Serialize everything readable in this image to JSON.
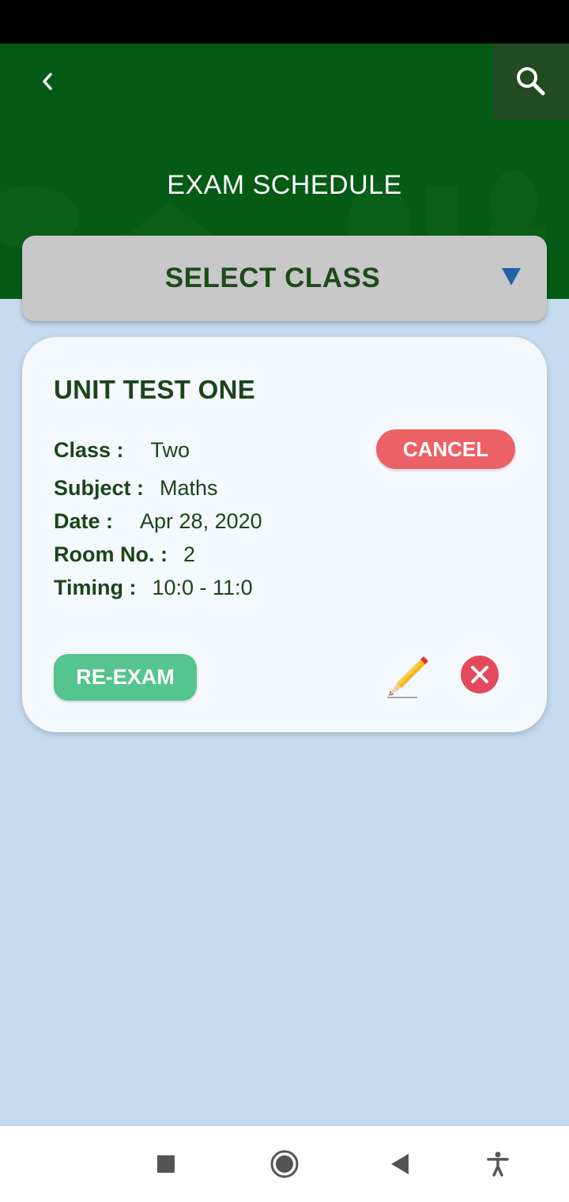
{
  "header": {
    "title": "EXAM SCHEDULE",
    "back_icon": "chevron-left-icon",
    "search_icon": "search-icon"
  },
  "class_selector": {
    "label": "SELECT CLASS",
    "icon": "triangle-down-icon"
  },
  "exam_card": {
    "name": "UNIT TEST ONE",
    "details": [
      {
        "label": "Class :",
        "value": "Two"
      },
      {
        "label": "Subject :",
        "value": "Maths"
      },
      {
        "label": "Date :",
        "value": "Apr 28, 2020"
      },
      {
        "label": "Room No. :",
        "value": "2"
      },
      {
        "label": "Timing :",
        "value": "10:0 - 11:0"
      }
    ],
    "cancel_label": "CANCEL",
    "reexam_label": "RE-EXAM",
    "edit_icon": "pencil-icon",
    "delete_icon": "close-circle-icon"
  },
  "navigation_bar": {
    "buttons": [
      "recent-apps-icon",
      "home-icon",
      "back-icon",
      "accessibility-icon"
    ]
  },
  "colors": {
    "header_green": "#055a15",
    "search_bg": "#234a22",
    "page_bg": "#c6dbef",
    "card_bg": "#f3f9fd",
    "title_text": "#1c4419",
    "cancel_red": "#ec6165",
    "reexam_green": "#56c48e",
    "delete_red": "#e24a5c",
    "dropdown_blue": "#1e62a8"
  }
}
